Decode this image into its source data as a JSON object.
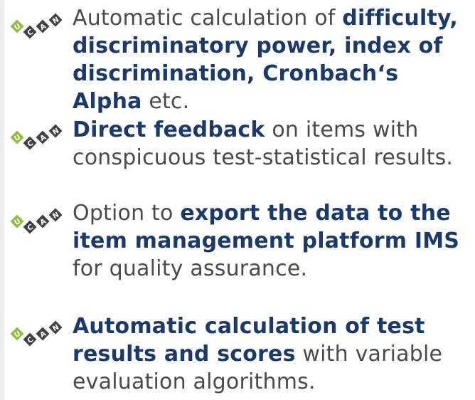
{
  "logo": {
    "letters": [
      "U",
      "C",
      "A",
      "N"
    ],
    "colors": {
      "green": "#8dbf3d",
      "dark": "#3f4347",
      "letter": "#ffffff"
    },
    "icon": "ucan-diamond-logo-icon"
  },
  "colors": {
    "text": "#4a4a4a",
    "bold": "#1b3a6c"
  },
  "features": [
    {
      "segments": [
        {
          "text": "Automatic calculation of ",
          "bold": false
        },
        {
          "text": "difficulty, discriminatory power, index of discri­mination, Cronbach‘s Alpha",
          "bold": true
        },
        {
          "text": " etc.",
          "bold": false
        }
      ]
    },
    {
      "segments": [
        {
          "text": "Direct feedback",
          "bold": true
        },
        {
          "text": " on items with conspi­cuous test-statistical results.",
          "bold": false
        }
      ]
    },
    {
      "segments": [
        {
          "text": "Option to ",
          "bold": false
        },
        {
          "text": "export the data to the item management platform IMS",
          "bold": true
        },
        {
          "text": " for quality assurance.",
          "bold": false
        }
      ]
    },
    {
      "segments": [
        {
          "text": "Automatic calculation of test results and scores",
          "bold": true
        },
        {
          "text": " with variable evaluation algorithms.",
          "bold": false
        }
      ]
    }
  ]
}
